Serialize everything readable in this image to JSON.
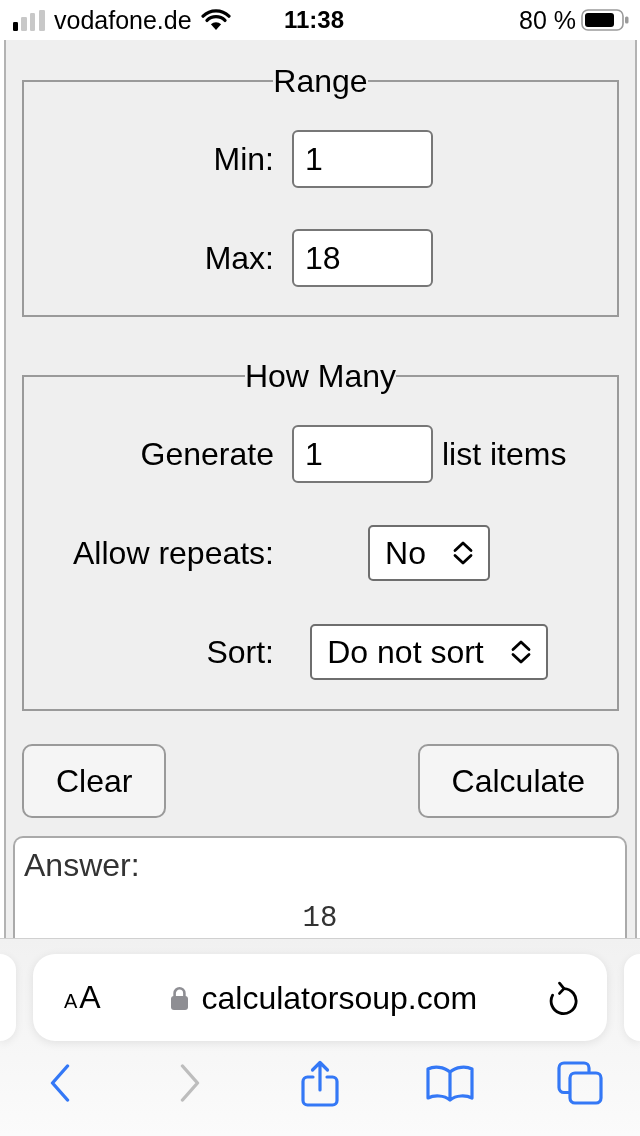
{
  "status_bar": {
    "carrier": "vodafone.de",
    "time": "11:38",
    "battery": "80 %"
  },
  "form": {
    "groups": [
      {
        "legend": "Range",
        "rows": [
          {
            "kind": "input",
            "label": "Min:",
            "value": "1"
          },
          {
            "kind": "input",
            "label": "Max:",
            "value": "18"
          }
        ]
      },
      {
        "legend": "How Many",
        "rows": [
          {
            "kind": "input",
            "label": "Generate",
            "value": "1",
            "suffix": "list items"
          },
          {
            "kind": "select",
            "label": "Allow repeats:",
            "value": "No"
          },
          {
            "kind": "select",
            "label": "Sort:",
            "value": "Do not sort"
          }
        ]
      }
    ],
    "buttons": [
      {
        "label": "Clear"
      },
      {
        "label": "Calculate"
      }
    ],
    "answer": {
      "label": "Answer:",
      "value": "18"
    }
  },
  "browser": {
    "page_settings": {
      "small_letter": "A",
      "large_letter": "A"
    },
    "url": "calculatorsoup.com",
    "toolbar": [
      {
        "kind": "back",
        "disabled": false
      },
      {
        "kind": "forward",
        "disabled": true
      },
      {
        "kind": "share",
        "disabled": false
      },
      {
        "kind": "bookmarks",
        "disabled": false
      },
      {
        "kind": "tabs",
        "disabled": false
      }
    ]
  }
}
